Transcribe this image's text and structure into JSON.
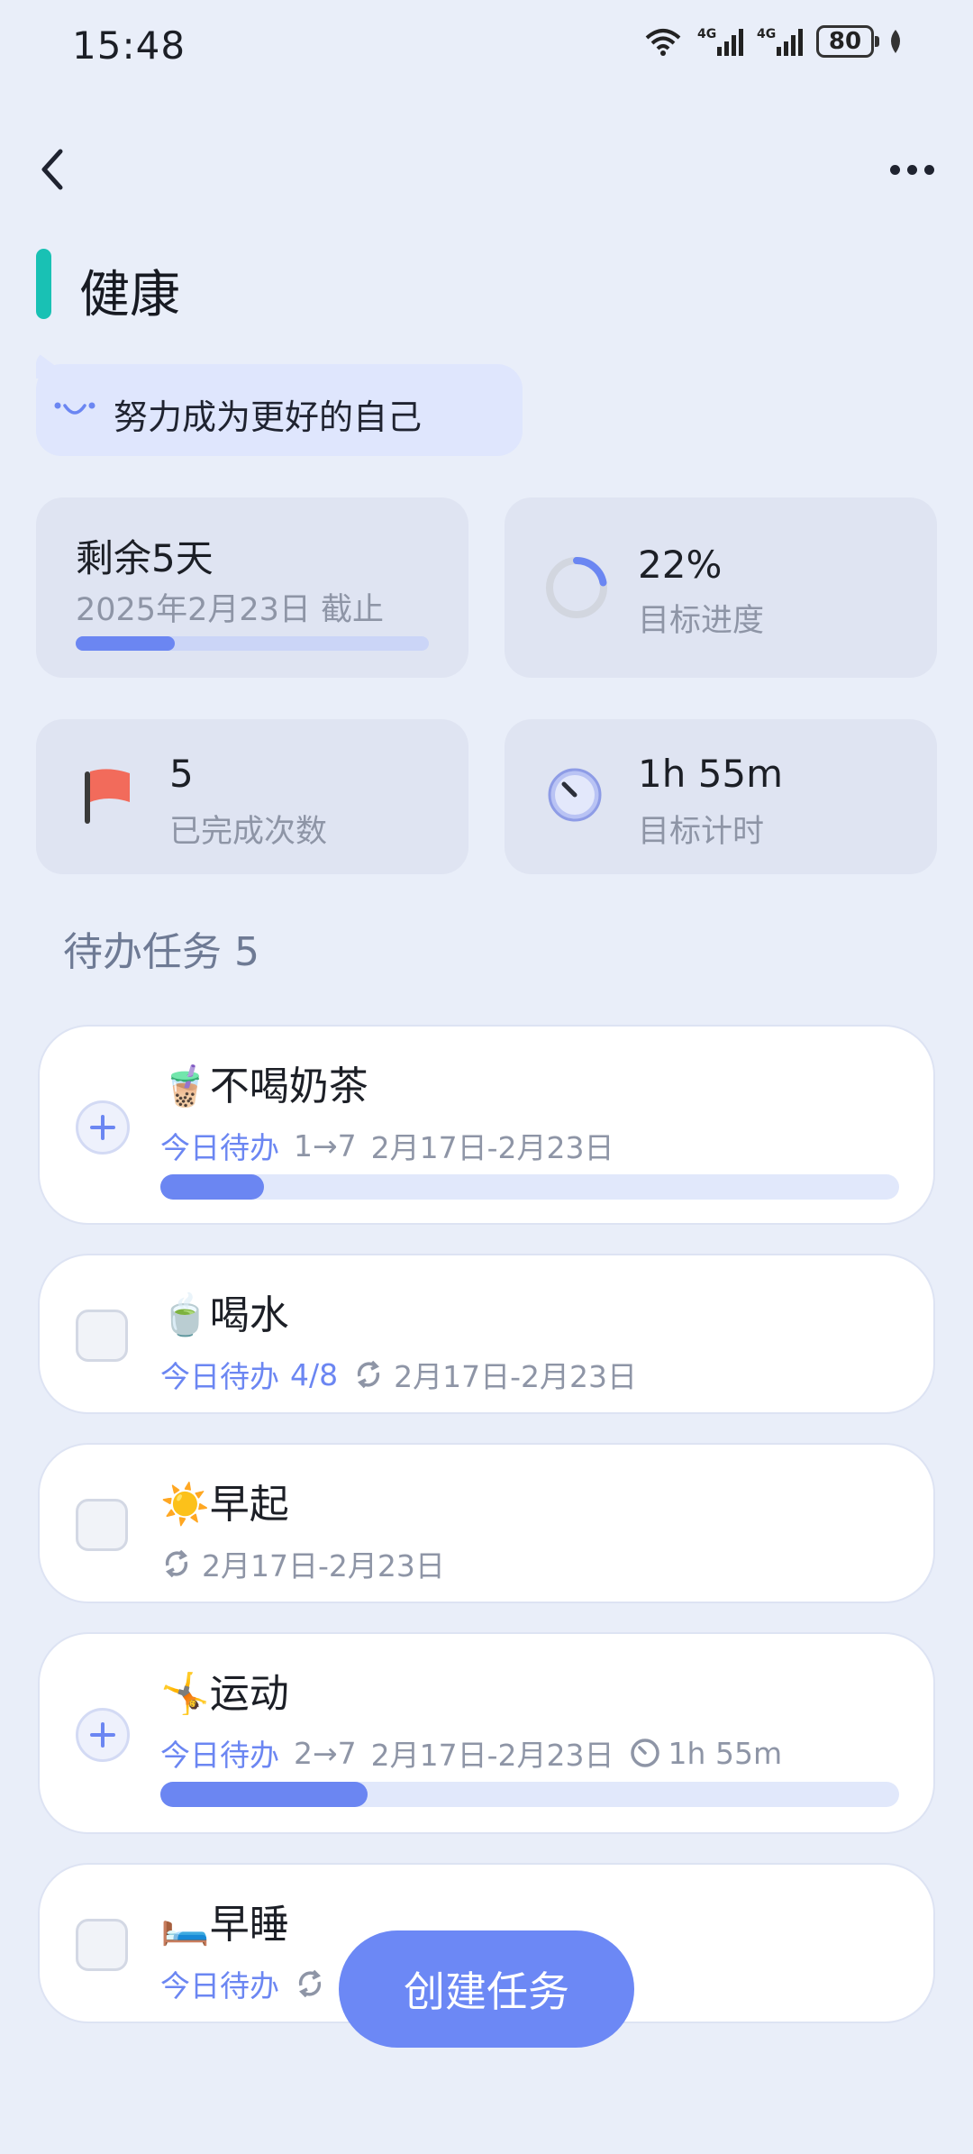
{
  "status_bar": {
    "time": "15:48",
    "battery": "80"
  },
  "page": {
    "title": "健康",
    "motto": "努力成为更好的自己",
    "accent_color": "#19c1b4",
    "brand_color": "#6b86f2"
  },
  "stats": {
    "remaining": {
      "label": "剩余5天",
      "deadline": "2025年2月23日 截止",
      "progress": 0.28
    },
    "goal_progress": {
      "value": "22%",
      "label": "目标进度",
      "fraction": 0.22
    },
    "completed": {
      "value": "5",
      "label": "已完成次数",
      "icon": "flag-icon"
    },
    "timer": {
      "value": "1h 55m",
      "label": "目标计时",
      "icon": "clock-icon"
    }
  },
  "tasks_section": {
    "title": "待办任务 5"
  },
  "tasks": [
    {
      "emoji": "🧋",
      "name": "不喝奶茶",
      "control": "plus",
      "today": "今日待办",
      "count": "1→7",
      "range": "2月17日-2月23日",
      "progress": 0.14
    },
    {
      "emoji": "🍵",
      "name": "喝水",
      "control": "checkbox",
      "today": "今日待办",
      "count": "4/8",
      "range": "2月17日-2月23日",
      "repeat": true
    },
    {
      "emoji": "☀️",
      "name": "早起",
      "control": "checkbox",
      "range": "2月17日-2月23日",
      "repeat": true
    },
    {
      "emoji": "🤸",
      "name": "运动",
      "control": "plus",
      "today": "今日待办",
      "count": "2→7",
      "range": "2月17日-2月23日",
      "duration": "1h 55m",
      "progress": 0.28
    },
    {
      "emoji": "🛏️",
      "name": "早睡",
      "control": "checkbox",
      "today": "今日待办",
      "repeat": true
    }
  ],
  "fab": {
    "label": "创建任务"
  }
}
